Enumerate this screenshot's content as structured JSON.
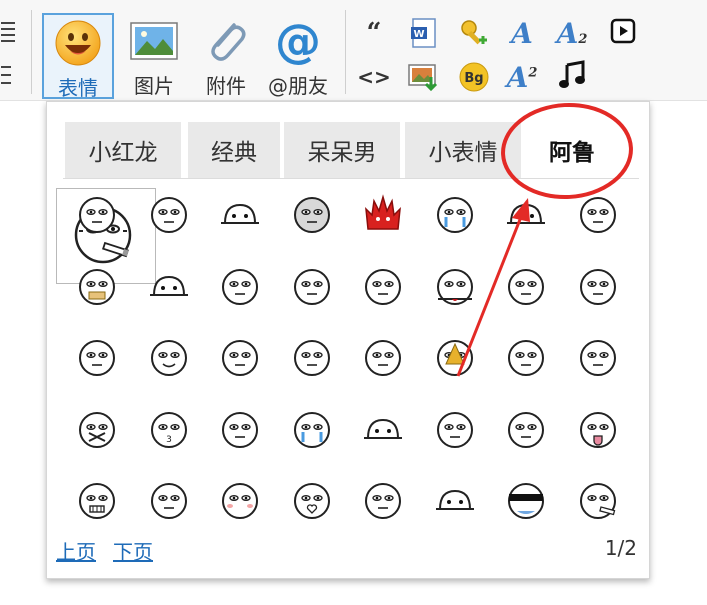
{
  "toolbar": {
    "buttons": [
      {
        "label": "表情",
        "icon": "smiley-face-icon",
        "active": true
      },
      {
        "label": "图片",
        "icon": "picture-icon",
        "active": false
      },
      {
        "label": "附件",
        "icon": "paperclip-icon",
        "active": false
      },
      {
        "label": "@朋友",
        "icon": "at-sign-icon",
        "active": false
      }
    ],
    "small_tools": [
      {
        "icon": "quote-icon"
      },
      {
        "icon": "word-document-icon"
      },
      {
        "icon": "key-icon"
      },
      {
        "icon": "font-style-icon"
      },
      {
        "icon": "subscript-icon"
      },
      {
        "icon": "video-play-icon"
      },
      {
        "icon": "code-icon"
      },
      {
        "icon": "insert-image-icon"
      },
      {
        "icon": "background-color-icon",
        "text": "Bg"
      },
      {
        "icon": "superscript-icon"
      },
      {
        "icon": "music-note-icon"
      }
    ]
  },
  "emoji_popup": {
    "tabs": [
      {
        "label": "小红龙",
        "active": false
      },
      {
        "label": "经典",
        "active": false
      },
      {
        "label": "呆呆男",
        "active": false
      },
      {
        "label": "小表情",
        "active": false
      },
      {
        "label": "阿鲁",
        "active": true
      }
    ],
    "grid": [
      [
        "aru-smoking-icon",
        "aru-crying-group-icon",
        "aru-tent-icon",
        "aru-plain-face-icon",
        "aru-red-fire-icon",
        "aru-blue-drool-icon",
        "aru-hiding-icon",
        "aru-shy-icon"
      ],
      [
        "aru-yellow-mouth-icon",
        "aru-peek-icon",
        "aru-sprout-icon",
        "aru-fear-icon",
        "aru-sad-icon",
        "aru-bleeding-icon",
        "aru-shocked-icon",
        "aru-spitting-icon"
      ],
      [
        "aru-shooting-icon",
        "aru-smile-icon",
        "aru-pressing-icon",
        "aru-blowing-icon",
        "aru-frown-icon",
        "aru-poop-icon",
        "aru-sparkle-icon",
        "aru-tired-icon"
      ],
      [
        "aru-shush-icon",
        "aru-three-mouth-icon",
        "aru-thinking-icon",
        "aru-blue-tears-icon",
        "aru-dome-icon",
        "aru-flower-icon",
        "aru-peach-butt-icon",
        "aru-tongue-icon"
      ],
      [
        "aru-teeth-icon",
        "aru-big-eyes-icon",
        "aru-blush-icon",
        "aru-heart-lips-icon",
        "aru-wavy-icon",
        "aru-eyes-only-icon",
        "aru-sunglasses-icon",
        "aru-cigar-icon"
      ]
    ],
    "preview_icon": "aru-smoking-icon",
    "pager": {
      "prev": "上页",
      "next": "下页",
      "count": "1/2"
    }
  },
  "colors": {
    "accent": "#1e6bb8",
    "highlight_border": "#5aa2dd",
    "annotation": "#e32a26"
  }
}
